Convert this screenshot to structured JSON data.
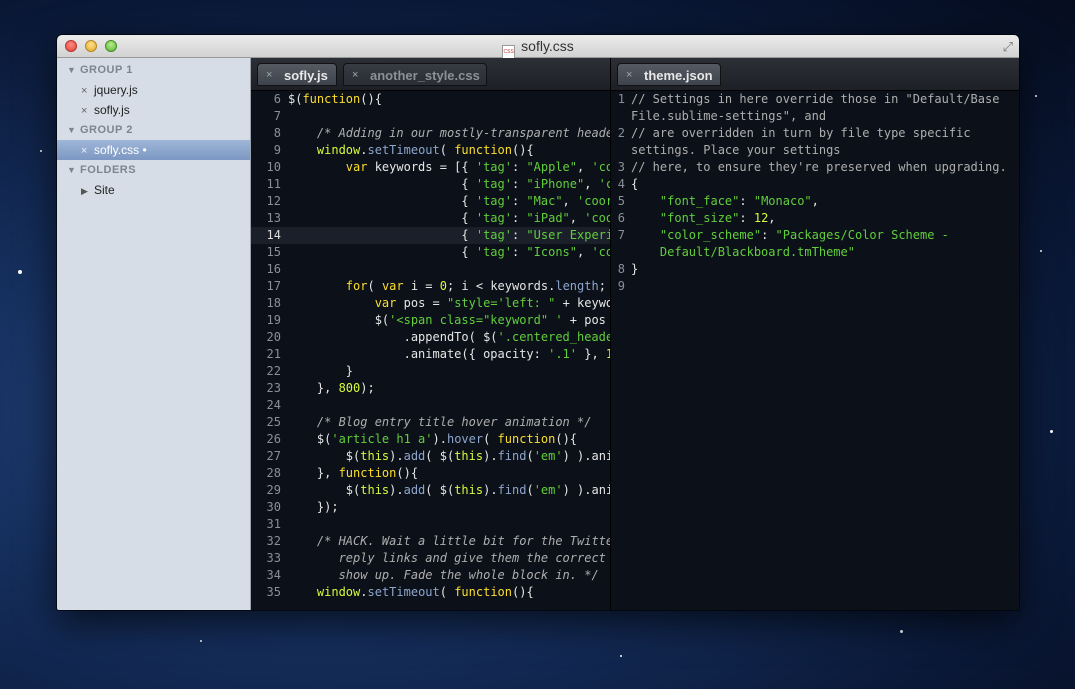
{
  "window": {
    "title": "sofly.css",
    "file_icon_label": "CSS"
  },
  "sidebar": {
    "groups": [
      {
        "label": "GROUP 1",
        "files": [
          "jquery.js",
          "sofly.js"
        ]
      },
      {
        "label": "GROUP 2",
        "files": [
          "sofly.css •"
        ]
      }
    ],
    "folders_label": "FOLDERS",
    "folders": [
      "Site"
    ]
  },
  "left_pane": {
    "tabs": [
      {
        "label": "sofly.js",
        "active": true
      },
      {
        "label": "another_style.css",
        "active": false
      }
    ],
    "line_numbers": [
      "6",
      "7",
      "8",
      "9",
      "10",
      "11",
      "12",
      "13",
      "14",
      "15",
      "16",
      "17",
      "18",
      "19",
      "20",
      "21",
      "22",
      "23",
      "24",
      "25",
      "26",
      "27",
      "28",
      "29",
      "30",
      "31",
      "32",
      "33",
      "34",
      "35"
    ],
    "current_line": "14"
  },
  "right_pane": {
    "tabs": [
      {
        "label": "theme.json",
        "active": true
      }
    ],
    "line_numbers": [
      "1",
      "2",
      "3",
      "4",
      "5",
      "6",
      "7",
      "8",
      "9"
    ]
  },
  "colors": {
    "keyword": "#fbde2d",
    "string": "#61ce3c",
    "comment": "#aeaeae",
    "number": "#d8fa3c",
    "function": "#8da6ce",
    "background": "#0c1018"
  }
}
